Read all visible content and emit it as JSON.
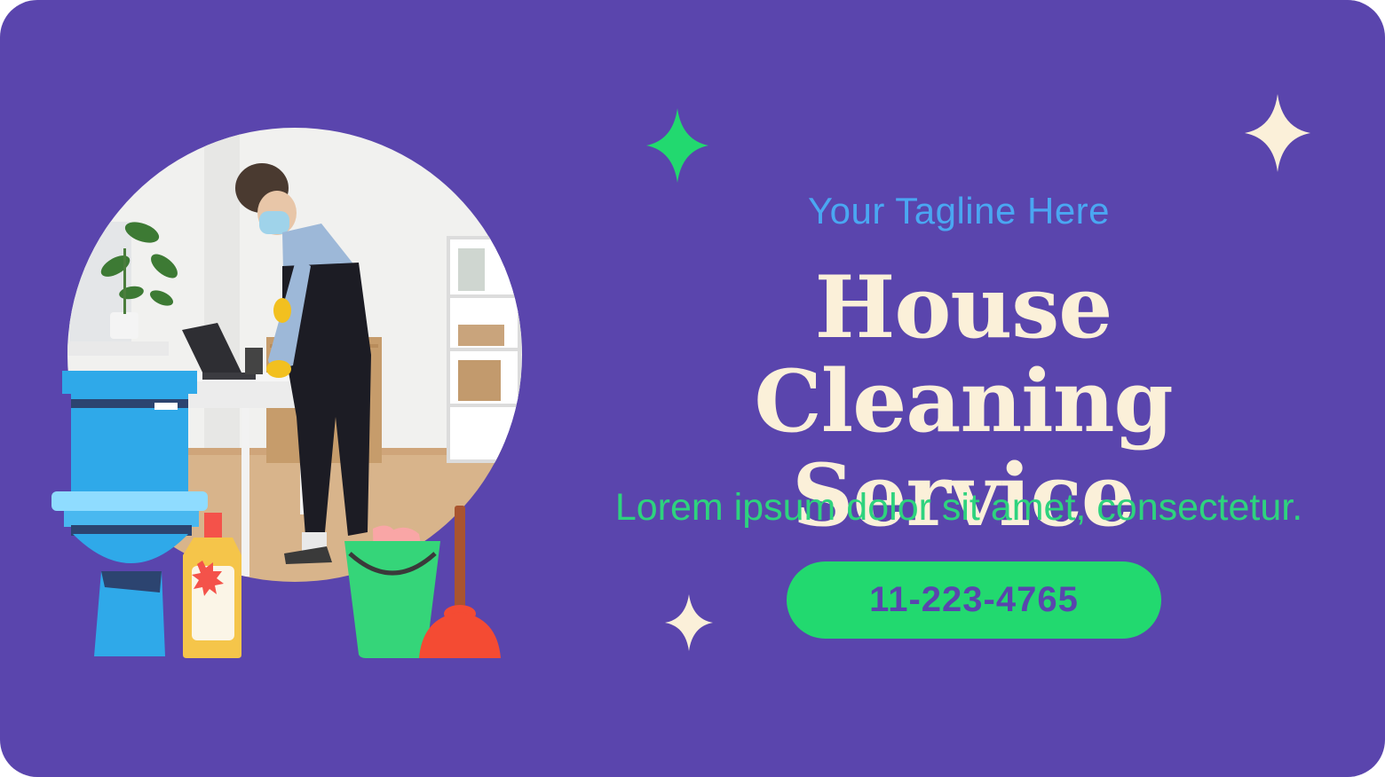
{
  "tagline": "Your Tagline Here",
  "headline": {
    "line1": "House Cleaning",
    "line2": "Service"
  },
  "body_text": "Lorem ipsum dolor sit amet, consectetur.",
  "phone_button": "11-223-4765",
  "colors": {
    "background": "#5a45ad",
    "tagline": "#4aa7f2",
    "headline": "#fbf0d9",
    "body_text": "#2ed37e",
    "button": "#22d96f",
    "sparkle_green": "#22d96f",
    "sparkle_cream": "#fbf0d9"
  },
  "icons": [
    "sparkle-icon",
    "toilet-icon",
    "cleaner-bottle-icon",
    "bucket-icon",
    "plunger-icon"
  ]
}
